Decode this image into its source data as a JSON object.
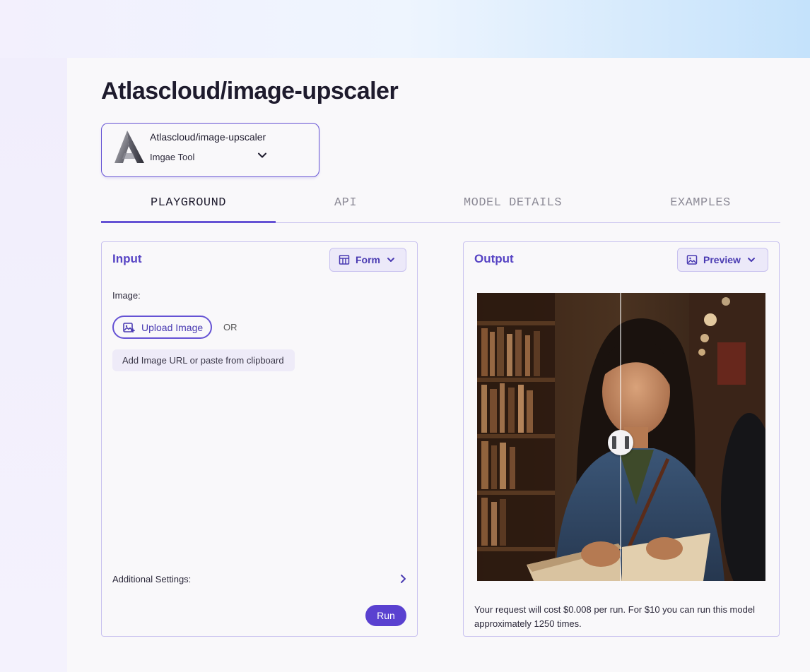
{
  "page": {
    "title": "Atlascloud/image-upscaler"
  },
  "model_selector": {
    "name": "Atlascloud/image-upscaler",
    "type": "Imgae Tool"
  },
  "tabs": [
    {
      "label": "PLAYGROUND",
      "active": true
    },
    {
      "label": "API",
      "active": false
    },
    {
      "label": "MODEL DETAILS",
      "active": false
    },
    {
      "label": "EXAMPLES",
      "active": false
    }
  ],
  "input_panel": {
    "title": "Input",
    "view_button": "Form",
    "image_label": "Image:",
    "upload_button": "Upload Image",
    "or_text": "OR",
    "url_placeholder": "Add Image URL or paste from clipboard",
    "additional_settings_label": "Additional Settings:",
    "run_button": "Run"
  },
  "output_panel": {
    "title": "Output",
    "view_button": "Preview",
    "cost_text": "Your request will cost $0.008 per run. For $10 you can run this model approximately 1250 times."
  },
  "colors": {
    "accent": "#5a41d0",
    "accent_text": "#5643c4",
    "border": "#c8c1ef",
    "page_bg": "#f9f8fa"
  }
}
